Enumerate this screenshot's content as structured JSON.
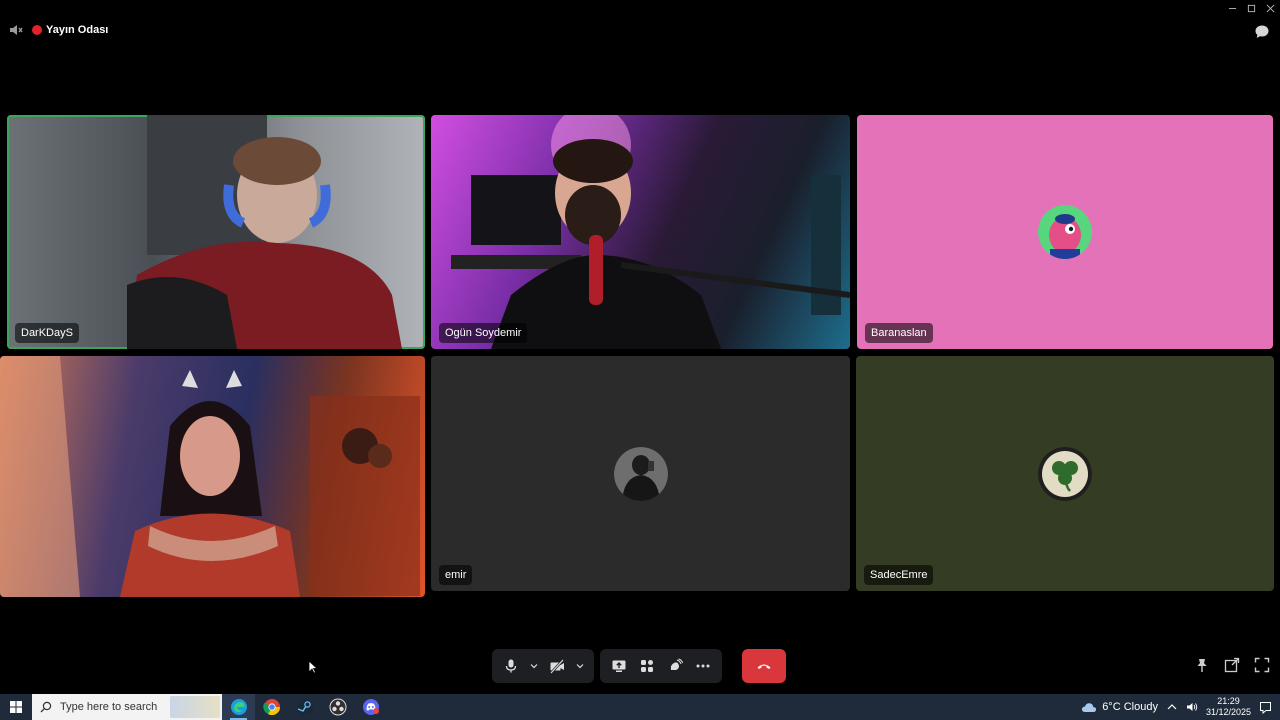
{
  "window": {
    "room_title": "Yayın Odası"
  },
  "tiles": [
    {
      "name": "DarKDayS",
      "speaking": true
    },
    {
      "name": "Ogün Soydemir",
      "speaking": false
    },
    {
      "name": "Baranaslan",
      "speaking": false
    },
    {
      "name": "",
      "speaking": false
    },
    {
      "name": "emir",
      "speaking": false
    },
    {
      "name": "SadecEmre",
      "speaking": false
    }
  ],
  "controls": {
    "icons": [
      "microphone-icon",
      "camera-off-icon",
      "screen-share-icon",
      "activities-icon",
      "soundboard-icon",
      "more-icon",
      "hang-up-icon"
    ]
  },
  "taskbar": {
    "search_placeholder": "Type here to search",
    "weather": "6°C  Cloudy",
    "time": "21:29",
    "date": "31/12/2025"
  },
  "colors": {
    "speaking_outline": "#3ba55c",
    "hangup": "#da373c",
    "live_dot": "#e2232a",
    "tile_baranaslan": "#e472b8",
    "tile_emir": "#2b2b2b",
    "tile_sadecemre": "#343d23"
  }
}
